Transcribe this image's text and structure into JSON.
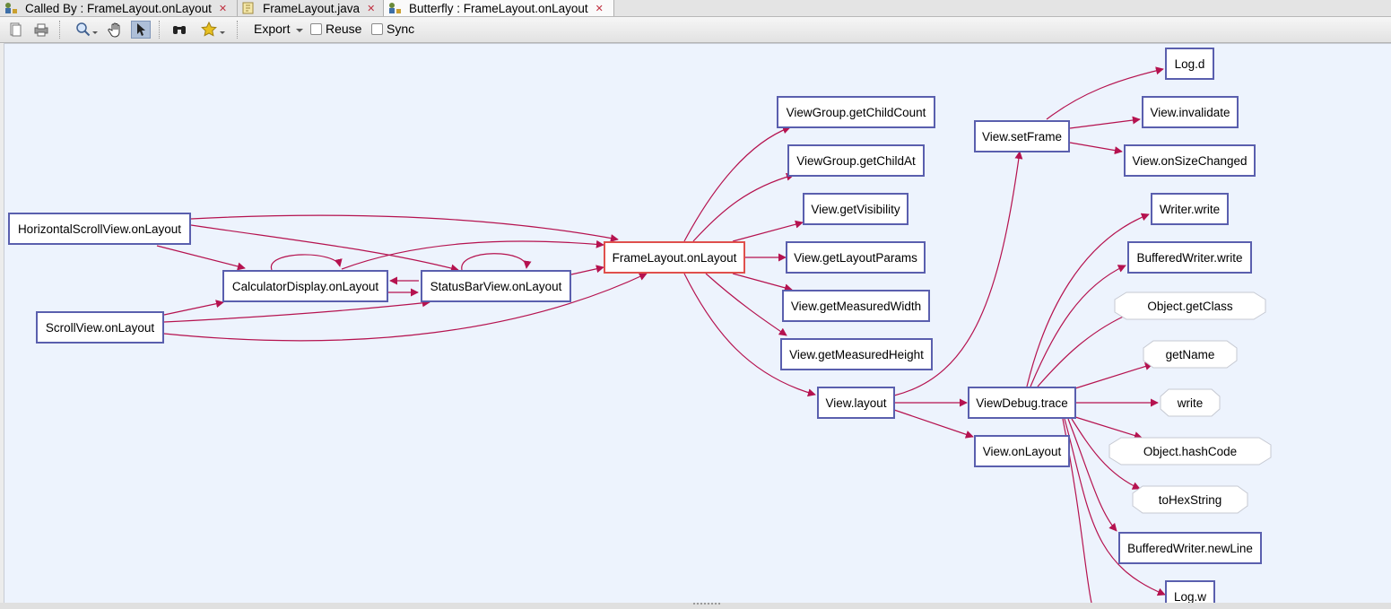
{
  "tabs": [
    {
      "label": "Called By : FrameLayout.onLayout",
      "icon": "call-hierarchy-icon",
      "active": false
    },
    {
      "label": "FrameLayout.java",
      "icon": "java-file-icon",
      "active": false
    },
    {
      "label": "Butterfly : FrameLayout.onLayout",
      "icon": "butterfly-icon",
      "active": true
    }
  ],
  "toolbar": {
    "export_label": "Export",
    "reuse_label": "Reuse",
    "sync_label": "Sync",
    "icons": [
      "new-page-icon",
      "print-icon",
      "zoom-icon",
      "hand-pan-icon",
      "select-pointer-icon",
      "binoculars-icon",
      "star-icon"
    ]
  },
  "graph": {
    "nodes": {
      "hsv": "HorizontalScrollView.onLayout",
      "sv": "ScrollView.onLayout",
      "cd": "CalculatorDisplay.onLayout",
      "sb": "StatusBarView.onLayout",
      "fl": "FrameLayout.onLayout",
      "gcc": "ViewGroup.getChildCount",
      "gca": "ViewGroup.getChildAt",
      "gv": "View.getVisibility",
      "glp": "View.getLayoutParams",
      "gmw": "View.getMeasuredWidth",
      "gmh": "View.getMeasuredHeight",
      "vl": "View.layout",
      "vsf": "View.setFrame",
      "vdt": "ViewDebug.trace",
      "vol": "View.onLayout",
      "logd": "Log.d",
      "vinv": "View.invalidate",
      "vosc": "View.onSizeChanged",
      "ww": "Writer.write",
      "bww": "BufferedWriter.write",
      "ogc": "Object.getClass",
      "gn": "getName",
      "wr": "write",
      "ohc": "Object.hashCode",
      "ths": "toHexString",
      "bwnl": "BufferedWriter.newLine",
      "logw": "Log.w"
    },
    "edge_color": "#b5124f",
    "focus_color": "#e0504c",
    "node_border_color": "#5a5fae"
  }
}
